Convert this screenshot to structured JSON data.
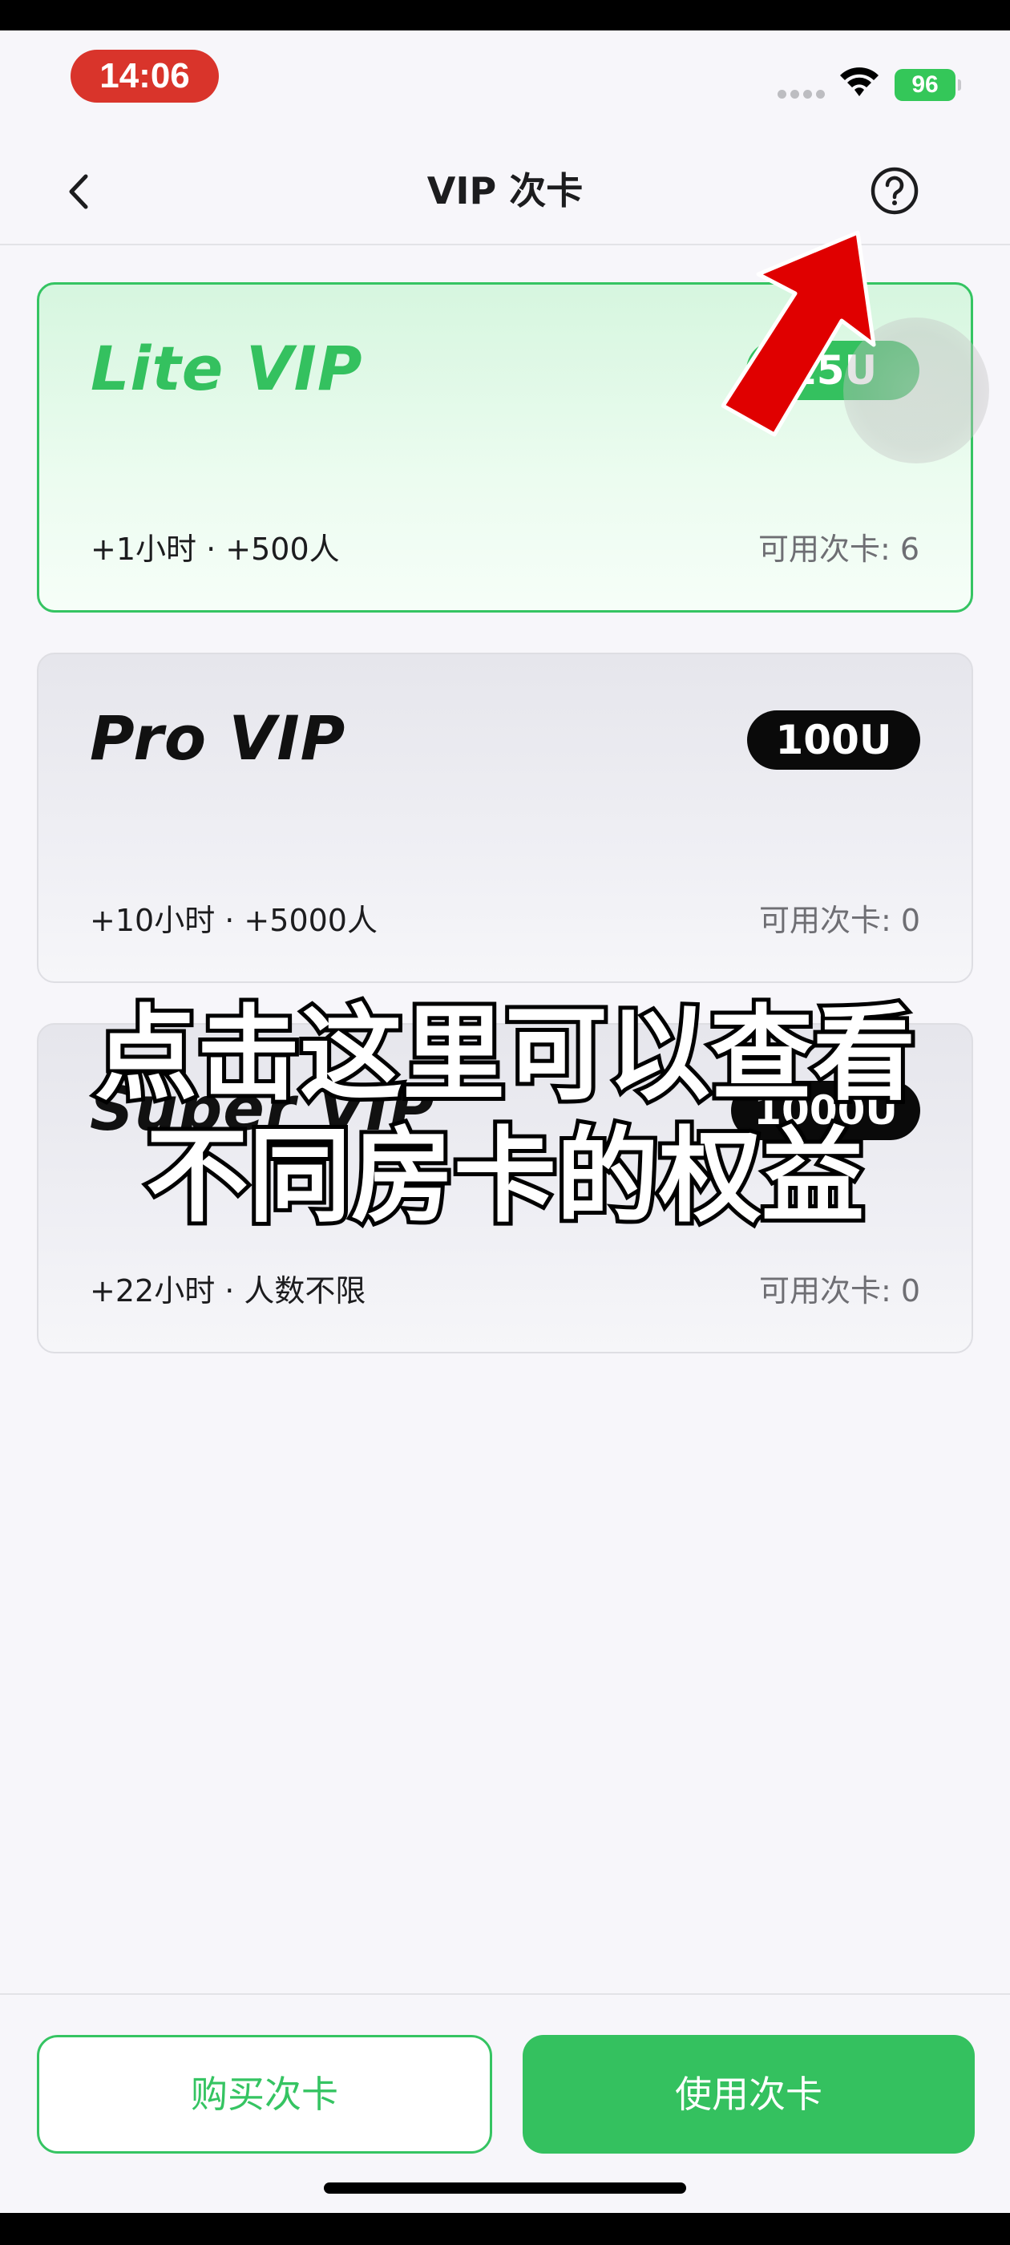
{
  "status_bar": {
    "time": "14:06",
    "battery": "96"
  },
  "nav": {
    "title": "VIP 次卡",
    "back_icon": "chevron-left-icon",
    "help_icon": "question-circle-icon"
  },
  "cards": [
    {
      "name": "Lite VIP",
      "badge": "15U",
      "desc": "+1小时 · +500人",
      "count": "可用次卡: 6",
      "selected": true
    },
    {
      "name": "Pro VIP",
      "badge": "100U",
      "desc": "+10小时 · +5000人",
      "count": "可用次卡: 0",
      "selected": false
    },
    {
      "name": "Super VIP",
      "badge": "1000U",
      "desc": "+22小时 · 人数不限",
      "count": "可用次卡: 0",
      "selected": false
    }
  ],
  "caption": {
    "line1": "点击这里可以查看",
    "line2": "不同房卡的权益"
  },
  "actions": {
    "buy_label": "购买次卡",
    "use_label": "使用次卡"
  },
  "colors": {
    "accent": "#34c15f",
    "time_badge": "#d9342b",
    "arrow": "#e00000"
  }
}
